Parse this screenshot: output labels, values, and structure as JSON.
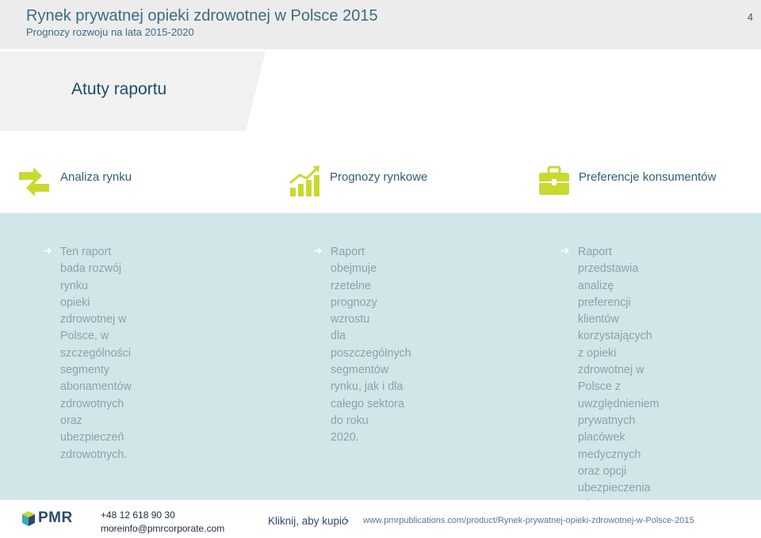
{
  "header": {
    "title": "Rynek prywatnej opieki zdrowotnej w Polsce 2015",
    "subtitle": "Prognozy rozwoju na lata 2015-2020",
    "page_number": "4"
  },
  "banner": {
    "label": "Atuty raportu"
  },
  "categories": [
    {
      "label": "Analiza rynku",
      "icon": "exchange-arrows-icon"
    },
    {
      "label": "Prognozy rynkowe",
      "icon": "growth-chart-icon"
    },
    {
      "label": "Preferencje konsumentów",
      "icon": "briefcase-icon"
    }
  ],
  "columns": [
    {
      "bullet": "➜",
      "text": "Ten raport bada rozwój rynku\nopieki zdrowotnej w Polsce, w\nszczególności segmenty\nabonamentów zdrowotnych\noraz ubezpieczeń zdrowotnych."
    },
    {
      "bullet": "➜",
      "text": "Raport obejmuje\nrzetelne prognozy wzrostu\ndla poszczególnych\nsegmentów rynku, jak i dla\ncałego sektora do roku\n2020."
    },
    {
      "bullet": "➜",
      "text": "Raport przedstawia analizę\npreferencji klientów korzystających\nz opieki zdrowotnej w Polsce z\nuwzględnieniem prywatnych\nplacówek medycznych oraz opcji\nubezpieczenia zdrowotnego."
    }
  ],
  "footer": {
    "logo_text": "PMR",
    "phone": "+48 12 618 90 30",
    "email": "moreinfo@pmrcorporate.com",
    "buy_label": "Kliknij, aby kupić",
    "buy_arrow": "›",
    "url": "www.pmrpublications.com/product/Rynek-prywatnej-opieki-zdrowotnej-w-Polsce-2015"
  },
  "colors": {
    "accent_green": "#c9d92f",
    "title_blue": "#3d6b82",
    "panel_bg": "#d1e6e9",
    "header_bg": "#ececec"
  }
}
